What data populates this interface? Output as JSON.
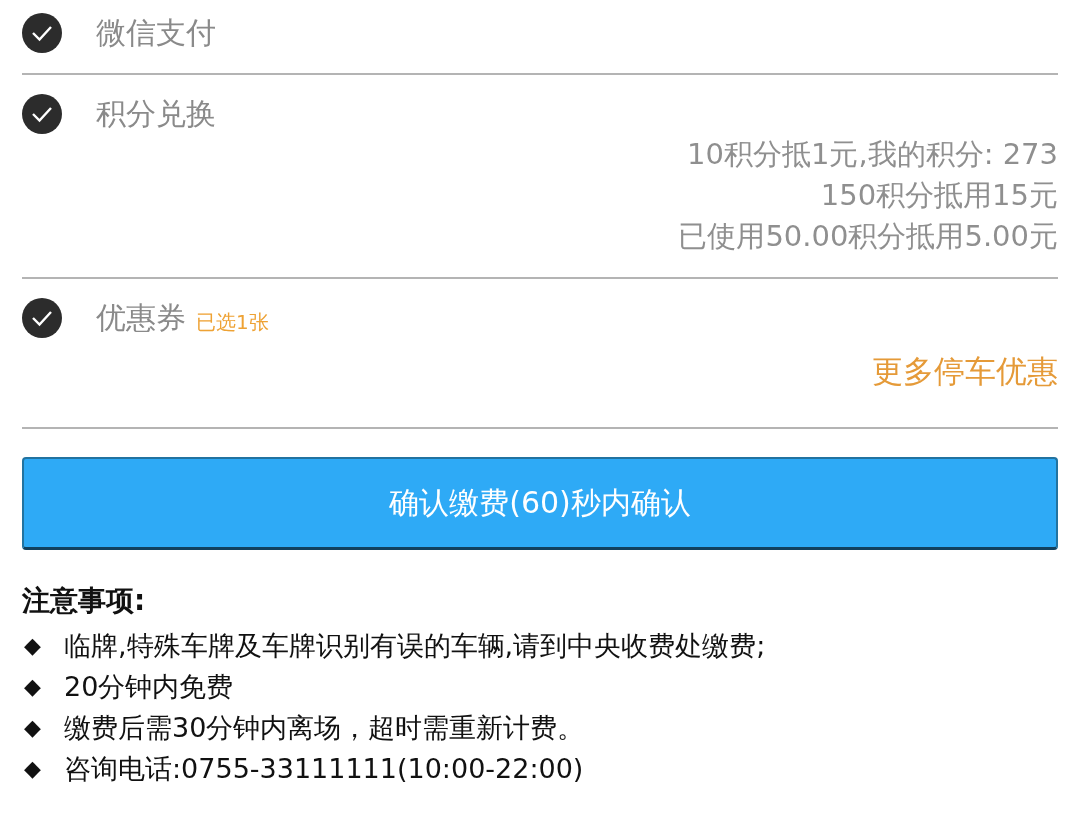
{
  "payment_options": [
    {
      "label": "微信支付",
      "checked": true
    },
    {
      "label": "积分兑换",
      "checked": true,
      "details": [
        "10积分抵1元,我的积分: 273",
        "150积分抵用15元",
        "已使用50.00积分抵用5.00元"
      ]
    },
    {
      "label": "优惠券",
      "checked": true,
      "badge": "已选1张",
      "link": "更多停车优惠"
    }
  ],
  "confirm_button": {
    "label": "确认缴费(60)秒内确认"
  },
  "notes": {
    "title": "注意事项:",
    "items": [
      {
        "marker": "◆",
        "text": "临牌,特殊车牌及车牌识别有误的车辆,请到中央收费处缴费;"
      },
      {
        "marker": "◆",
        "text": "20分钟内免费"
      },
      {
        "marker": "◆",
        "text": "缴费后需30分钟内离场，超时需重新计费。"
      },
      {
        "marker": "◆",
        "text": "咨询电话:0755-33111111(10:00-22:00)"
      }
    ]
  }
}
